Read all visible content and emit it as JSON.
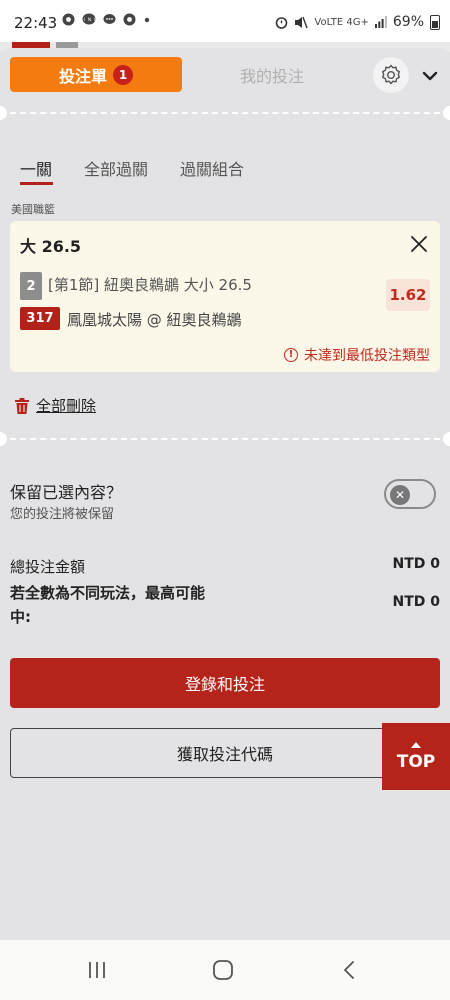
{
  "status_bar": {
    "time": "22:43",
    "left_icons": [
      "chrome-icon",
      "line-icon",
      "chat-icon",
      "chrome-icon",
      "dot-icon"
    ],
    "network": "VoLTE 4G+",
    "battery_percent": "69%"
  },
  "header": {
    "betslip_tab_label": "投注單",
    "betslip_count": "1",
    "mybets_tab_label": "我的投注",
    "settings_icon": "gear-icon",
    "collapse_icon": "chevron-down-icon"
  },
  "subtabs": {
    "items": [
      "一關",
      "全部過關",
      "過關組合"
    ],
    "active": "一關"
  },
  "league": "美國職籃",
  "bet": {
    "title": "大 26.5",
    "period_badge": "2",
    "market": "[第1節] 紐奧良鵜鶘 大小 26.5",
    "odds": "1.62",
    "event_id": "317",
    "event_name": "鳳凰城太陽 @ 紐奧良鵜鶘",
    "warning": "未達到最低投注類型"
  },
  "actions": {
    "delete_all": "全部刪除"
  },
  "keep_selection": {
    "title": "保留已選內容？",
    "subtitle": "您的投注將被保留",
    "enabled": false
  },
  "summary": {
    "total_stake_label": "總投注金額",
    "total_stake_value": "NTD 0",
    "max_win_label": "若全數為不同玩法，最高可能中:",
    "max_win_value": "NTD 0"
  },
  "buttons": {
    "login_bet": "登錄和投注",
    "get_code": "獲取投注代碼",
    "top": "TOP"
  },
  "colors": {
    "accent_orange": "#f47b0f",
    "brand_red": "#b5241b",
    "card_bg": "#fbf8ea",
    "panel_bg": "#e3e3e5"
  }
}
